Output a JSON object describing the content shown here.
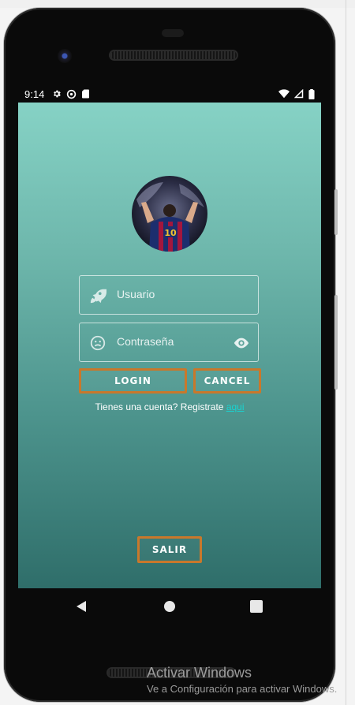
{
  "status_bar": {
    "time": "9:14",
    "icons_left": [
      "gear-icon",
      "sync-icon",
      "sd-card-icon"
    ],
    "icons_right": [
      "wifi-icon",
      "signal-icon",
      "battery-icon"
    ]
  },
  "login": {
    "avatar_alt": "",
    "username_placeholder": "Usuario",
    "password_placeholder": "Contraseña",
    "login_label": "LOGIN",
    "cancel_label": "CANCEL",
    "register_prompt": "Tienes una cuenta? Registrate ",
    "register_link": "aqui",
    "exit_label": "SALIR"
  },
  "nav": {
    "back_icon": "back-triangle-icon",
    "home_icon": "home-circle-icon",
    "recents_icon": "recents-square-icon"
  },
  "watermark": {
    "title": "Activar Windows",
    "subtitle": "Ve a Configuración para activar Windows."
  },
  "colors": {
    "screen_top": "#86d2c5",
    "screen_bottom": "#2f6e6a",
    "button_border": "#c9782b",
    "link": "#19d3d1"
  }
}
